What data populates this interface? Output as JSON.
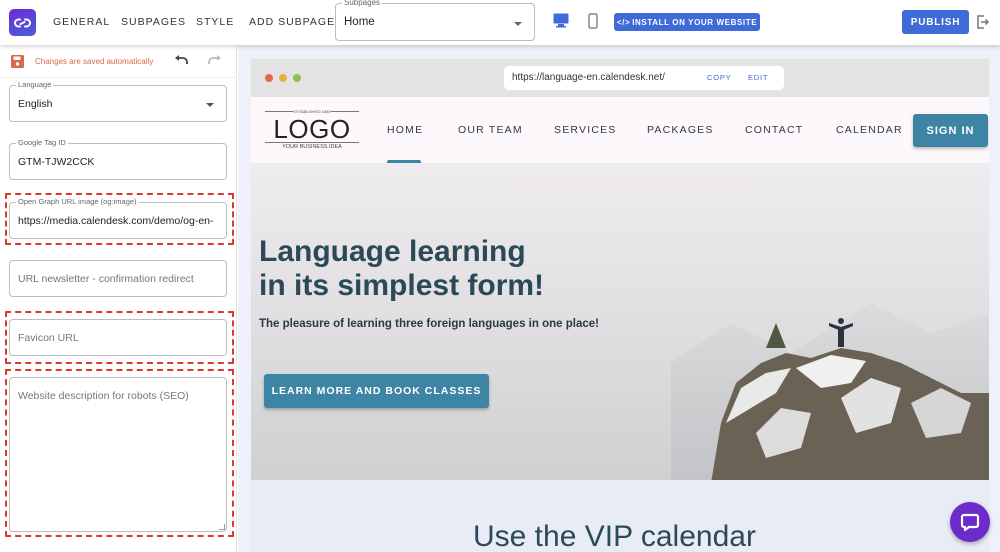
{
  "topbar": {
    "nav": [
      "GENERAL",
      "SUBPAGES",
      "STYLE",
      "ADD SUBPAGE"
    ],
    "subpage_select": {
      "label": "Subpages",
      "value": "Home"
    },
    "install_button": "INSTALL ON YOUR WEBSITE",
    "publish_button": "PUBLISH",
    "brand_color": "#3f6ad8"
  },
  "left_panel": {
    "save_status": "Changes are saved automatically",
    "fields": {
      "language": {
        "label": "Language",
        "value": "English"
      },
      "google_tag": {
        "label": "Google Tag ID",
        "value": "GTM-TJW2CCK"
      },
      "og_image": {
        "label": "Open Graph URL image (og:image)",
        "value": "https://media.calendesk.com/demo/og-en-"
      },
      "newsletter_redirect": {
        "placeholder": "URL newsletter - confirmation redirect",
        "value": ""
      },
      "favicon": {
        "placeholder": "Favicon URL",
        "value": ""
      },
      "seo_description": {
        "placeholder": "Website description for robots (SEO)",
        "value": ""
      }
    }
  },
  "preview": {
    "url": "https://language-en.calendesk.net/",
    "copy_label": "COPY",
    "edit_label": "EDIT",
    "logo": {
      "established": "ESTABLISHED 1889",
      "text": "LOGO",
      "tagline": "YOUR BUSINESS IDEA"
    },
    "menu": [
      "HOME",
      "OUR TEAM",
      "SERVICES",
      "PACKAGES",
      "CONTACT",
      "CALENDAR"
    ],
    "active_menu": "HOME",
    "sign_in": "SIGN IN",
    "hero": {
      "title_line1": "Language learning",
      "title_line2": "in its simplest form!",
      "subtitle": "The pleasure of learning three foreign languages in one place!",
      "cta": "LEARN MORE AND BOOK CLASSES"
    },
    "section2_title": "Use the VIP calendar",
    "accent_color": "#3d84a5"
  }
}
